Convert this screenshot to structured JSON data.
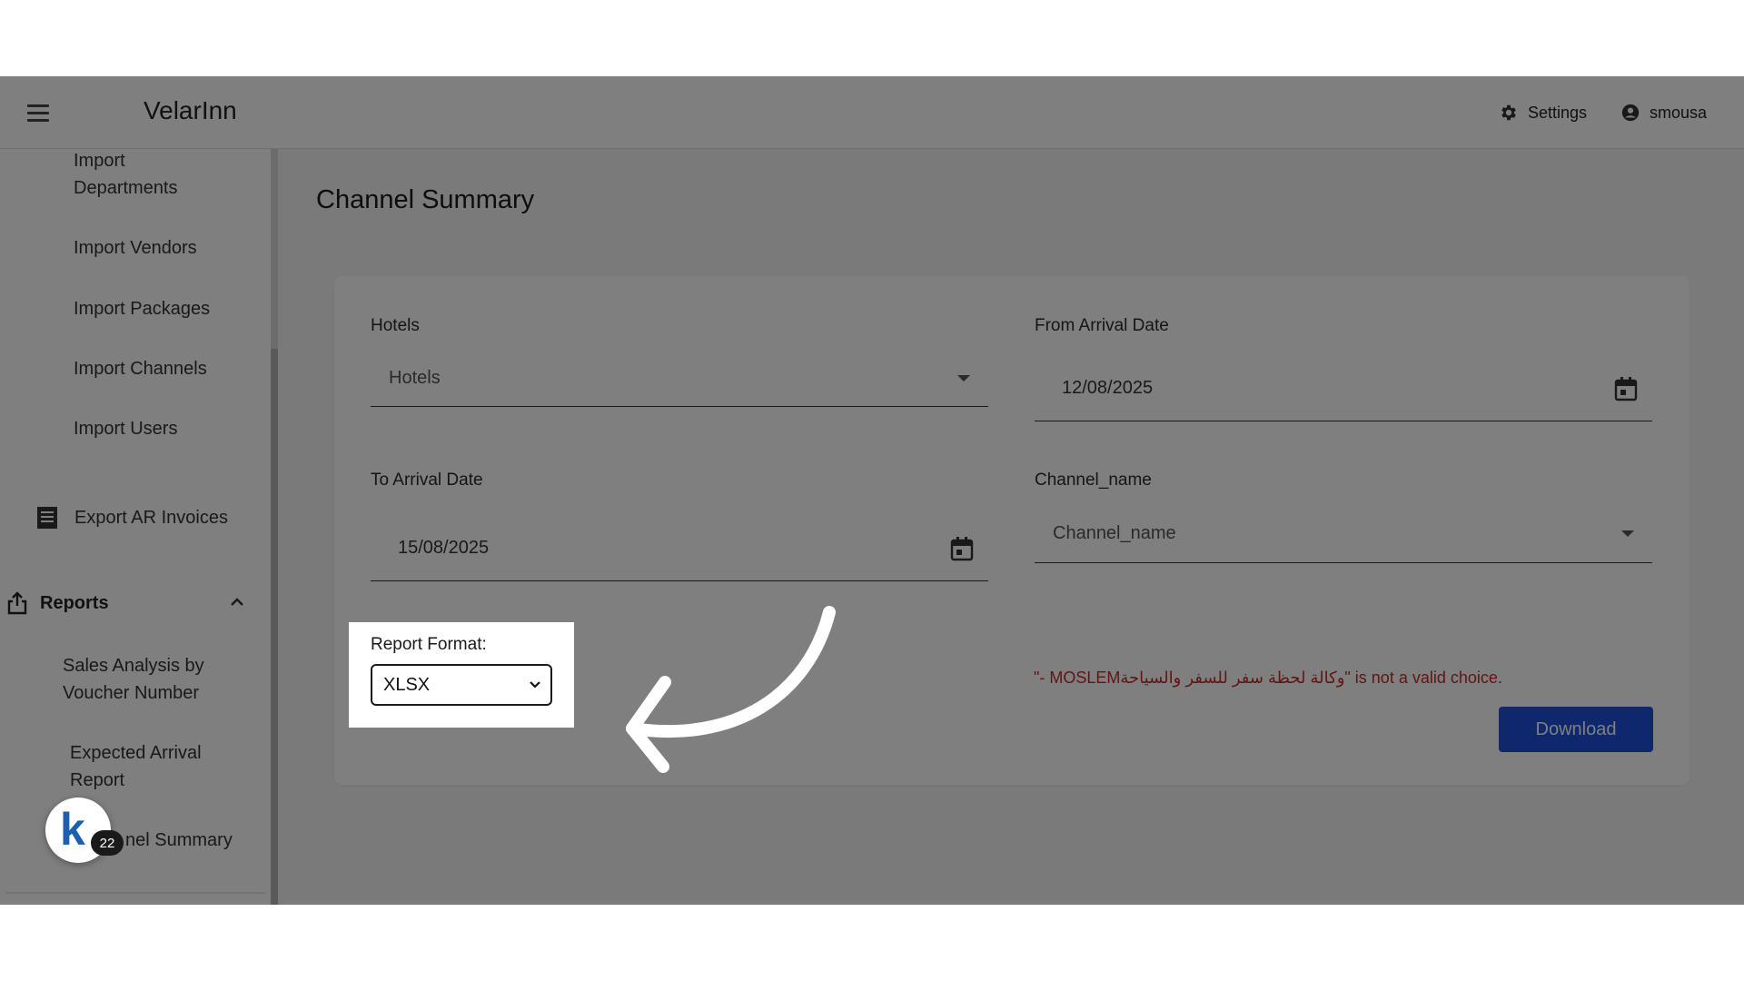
{
  "header": {
    "app_title": "VelarInn",
    "settings_label": "Settings",
    "user_name": "smousa"
  },
  "sidebar": {
    "items": [
      {
        "label_line1": "Import",
        "label_line2": "Departments"
      },
      {
        "label": "Import Vendors"
      },
      {
        "label": "Import Packages"
      },
      {
        "label": "Import Channels"
      },
      {
        "label": "Import Users"
      },
      {
        "label": "Export AR Invoices"
      }
    ],
    "reports_section": {
      "label": "Reports",
      "items": [
        {
          "label_line1": "Sales Analysis by",
          "label_line2": "Voucher Number"
        },
        {
          "label_line1": "Expected Arrival",
          "label_line2": "Report"
        },
        {
          "label": "nel Summary"
        }
      ]
    }
  },
  "widget": {
    "avatar_letter": "k",
    "badge_count": "22"
  },
  "main": {
    "page_title": "Channel Summary",
    "hotels": {
      "label": "Hotels",
      "placeholder": "Hotels"
    },
    "from_date": {
      "label": "From Arrival Date",
      "value": "12/08/2025"
    },
    "to_date": {
      "label": "To Arrival Date",
      "value": "15/08/2025"
    },
    "channel": {
      "label": "Channel_name",
      "placeholder": "Channel_name"
    },
    "error_text": "\"- MOSLEMوكالة لحظة سفر للسفر والسياحة\" is not a valid choice.",
    "report_format": {
      "label": "Report Format:",
      "selected": "XLSX"
    },
    "download_label": "Download"
  },
  "colors": {
    "accent": "#1e4fd8",
    "error": "#c62828",
    "overlay": "rgba(0,0,0,0.5)"
  }
}
